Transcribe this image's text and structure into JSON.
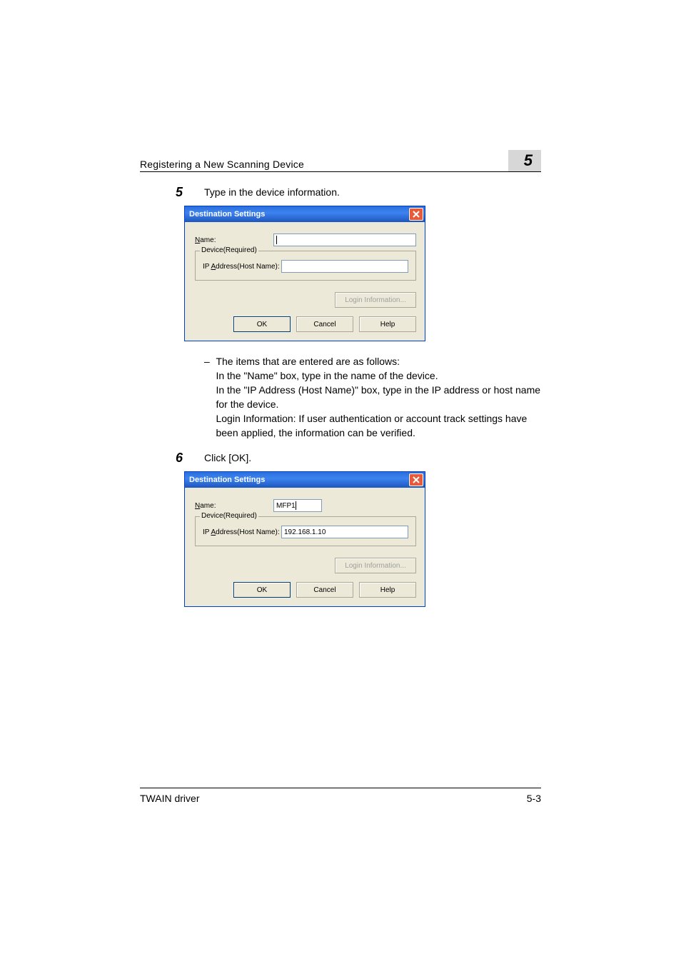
{
  "header": {
    "title": "Registering a New Scanning Device",
    "chapter_number": "5"
  },
  "step5": {
    "number": "5",
    "text": "Type in the device information."
  },
  "dialog1": {
    "title": "Destination Settings",
    "name_label_underline": "N",
    "name_label_rest": "ame:",
    "name_value": "",
    "fieldset_legend": "Device(Required)",
    "ip_label_pre": "IP ",
    "ip_label_underline": "A",
    "ip_label_rest": "ddress(Host Name):",
    "ip_value": "",
    "login_pre": "",
    "login_underline": "L",
    "login_rest": "ogin Information...",
    "ok": "OK",
    "cancel": "Cancel",
    "help_underline": "H",
    "help_rest": "elp"
  },
  "sublist": {
    "line1": "The items that are entered are as follows:",
    "line2": "In the \"Name\" box, type in the name of the device.",
    "line3": "In the \"IP Address (Host Name)\" box, type in the IP address or host name for the device.",
    "line4": "Login Information: If user authentication or account track settings have been applied, the information can be verified."
  },
  "step6": {
    "number": "6",
    "text": "Click [OK]."
  },
  "dialog2": {
    "title": "Destination Settings",
    "name_value": "MFP1",
    "ip_value": "192.168.1.10"
  },
  "footer": {
    "left": "TWAIN driver",
    "right": "5-3"
  }
}
